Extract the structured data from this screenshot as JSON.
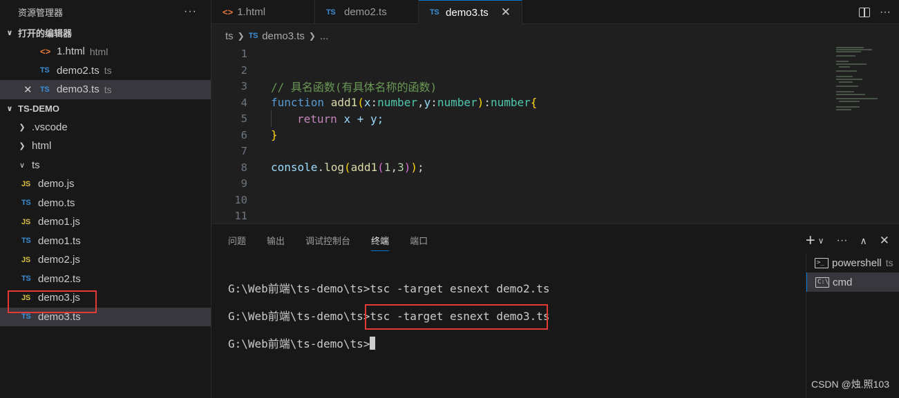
{
  "sidebar": {
    "title": "资源管理器",
    "more": "···",
    "open_editors": {
      "label": "打开的编辑器",
      "items": [
        {
          "icon": "<>",
          "name": "1.html",
          "desc": "html"
        },
        {
          "icon": "TS",
          "name": "demo2.ts",
          "desc": "ts"
        },
        {
          "icon": "TS",
          "name": "demo3.ts",
          "desc": "ts"
        }
      ]
    },
    "project": {
      "label": "TS-DEMO",
      "folders": [
        ".vscode",
        "html",
        "ts"
      ],
      "files": [
        {
          "icon": "JS",
          "name": "demo.js"
        },
        {
          "icon": "TS",
          "name": "demo.ts"
        },
        {
          "icon": "JS",
          "name": "demo1.js"
        },
        {
          "icon": "TS",
          "name": "demo1.ts"
        },
        {
          "icon": "JS",
          "name": "demo2.js"
        },
        {
          "icon": "TS",
          "name": "demo2.ts"
        },
        {
          "icon": "JS",
          "name": "demo3.js"
        },
        {
          "icon": "TS",
          "name": "demo3.ts"
        }
      ]
    }
  },
  "tabs": [
    {
      "icon": "<>",
      "label": "1.html"
    },
    {
      "icon": "TS",
      "label": "demo2.ts"
    },
    {
      "icon": "TS",
      "label": "demo3.ts"
    }
  ],
  "breadcrumb": {
    "folder": "ts",
    "icon": "TS",
    "file": "demo3.ts",
    "more": "..."
  },
  "editor": {
    "line_numbers": [
      "1",
      "2",
      "3",
      "4",
      "5",
      "6",
      "7",
      "8",
      "9",
      "10",
      "11"
    ],
    "comment": "// 具名函数(有具体名称的函数)",
    "tokens": {
      "function": "function",
      "name": "add1",
      "x": "x",
      "y": "y",
      "type": "number",
      "return": "return",
      "expr": "x + y;",
      "console": "console",
      "log": "log",
      "n1": "1",
      "n3": "3"
    }
  },
  "panel": {
    "tabs": [
      "问题",
      "输出",
      "调试控制台",
      "终端",
      "端口"
    ],
    "active_tab": "终端",
    "terminal_lines": [
      "G:\\Web前端\\ts-demo\\ts>tsc -target esnext demo2.ts",
      "G:\\Web前端\\ts-demo\\ts>",
      "G:\\Web前端\\ts-demo\\ts>"
    ],
    "highlighted_command": "tsc -target esnext demo3.ts",
    "terminals": [
      {
        "name": "powershell",
        "desc": "ts"
      },
      {
        "name": "cmd"
      }
    ]
  },
  "watermark": "CSDN @烛.照103",
  "colors": {
    "accent": "#0078d4",
    "highlight_box": "#e53935"
  }
}
